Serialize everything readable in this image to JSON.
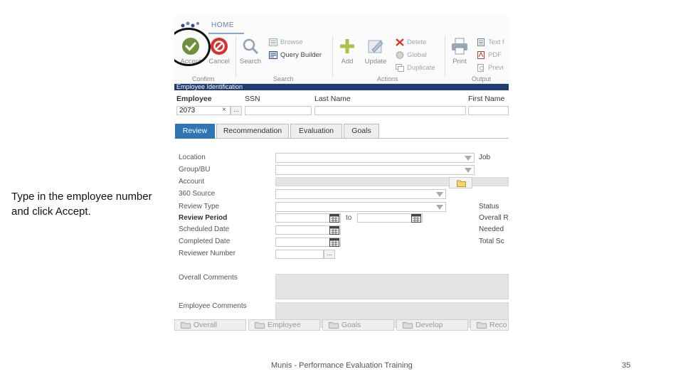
{
  "slide": {
    "instruction": "Type in the employee number and click Accept.",
    "footer_title": "Munis - Performance Evaluation Training",
    "page_number": "35"
  },
  "ribbon": {
    "home_tab": "HOME",
    "groups": {
      "confirm": "Confirm",
      "search": "Search",
      "actions": "Actions",
      "output": "Output"
    },
    "buttons": {
      "accept": "Accept",
      "cancel": "Cancel",
      "search": "Search",
      "browse": "Browse",
      "query_builder": "Query Builder",
      "add": "Add",
      "update": "Update",
      "delete": "Delete",
      "global": "Global",
      "duplicate": "Duplicate",
      "print": "Print",
      "text": "Text f",
      "pdf": "PDF",
      "preview": "Previ"
    }
  },
  "employee_identification": {
    "section_title": "Employee Identification",
    "headers": {
      "employee": "Employee",
      "ssn": "SSN",
      "last_name": "Last Name",
      "first_name": "First Name"
    },
    "employee_value": "2073",
    "clear_symbol": "×",
    "lookup_symbol": "..."
  },
  "tabs": [
    "Review",
    "Recommendation",
    "Evaluation",
    "Goals"
  ],
  "fields": {
    "location": "Location",
    "group_bu": "Group/BU",
    "account": "Account",
    "source_360": "360 Source",
    "review_type": "Review Type",
    "review_period": "Review Period",
    "to": "to",
    "scheduled_date": "Scheduled Date",
    "completed_date": "Completed Date",
    "reviewer_number": "Reviewer Number",
    "reviewer_lookup": "...",
    "overall_comments": "Overall Comments",
    "employee_comments": "Employee Comments"
  },
  "right_labels": {
    "job": "Job",
    "status": "Status",
    "overall": "Overall R",
    "needed": "Needed",
    "total_score": "Total Sc"
  },
  "bottom_buttons": [
    "Overall",
    "Employee",
    "Goals",
    "Develop",
    "Reco"
  ],
  "colors": {
    "section_header": "#1f3d72",
    "active_tab": "#2f74b5",
    "accept_green": "#6f8f3a",
    "cancel_red": "#d9322b"
  }
}
